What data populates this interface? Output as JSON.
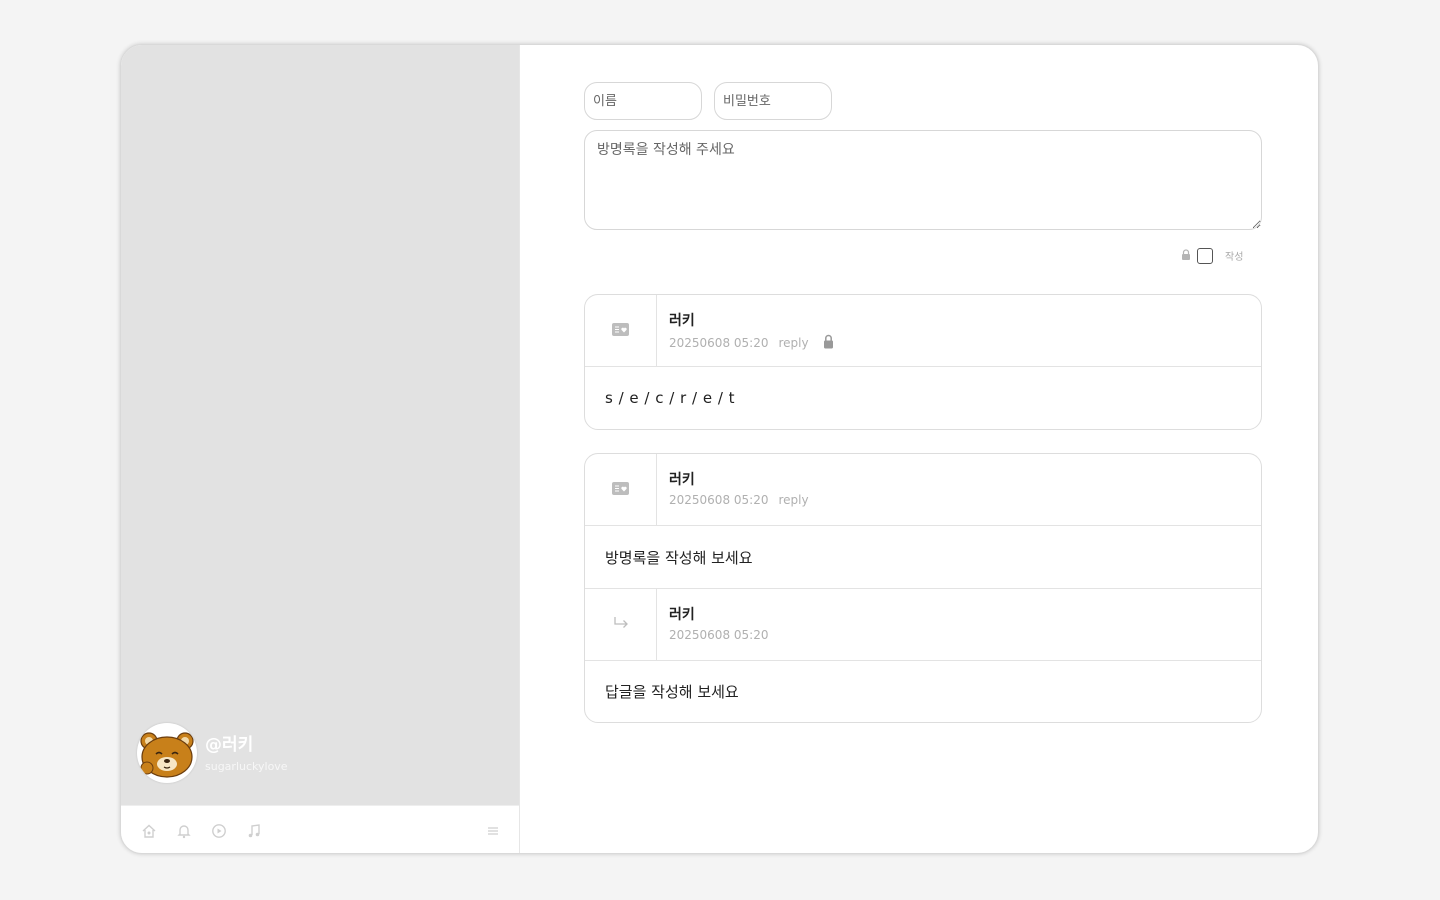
{
  "profile": {
    "handle": "@러키",
    "subtitle": "sugarluckylove",
    "avatar": "rilakkuma-bear-avatar"
  },
  "bottom_nav": {
    "icons": [
      "home-icon",
      "bell-icon",
      "chat-icon",
      "music-icon"
    ],
    "menu_icon": "menu-icon"
  },
  "form": {
    "name_placeholder": "이름",
    "password_placeholder": "비밀번호",
    "message_placeholder": "방명록을 작성해 주세요",
    "write_label": "작성"
  },
  "entries": [
    {
      "name": "러키",
      "date": "20250608 05:20",
      "reply_label": "reply",
      "locked": true,
      "content": "s / e / c / r / e / t"
    },
    {
      "name": "러키",
      "date": "20250608 05:20",
      "reply_label": "reply",
      "locked": false,
      "content": "방명록을 작성해 보세요",
      "reply": {
        "name": "러키",
        "date": "20250608 05:20",
        "content": "답글을 작성해 보세요"
      }
    }
  ],
  "colors": {
    "sidebar_bg": "#e2e2e2",
    "page_bg": "#f4f4f4",
    "border": "#dddddd"
  }
}
